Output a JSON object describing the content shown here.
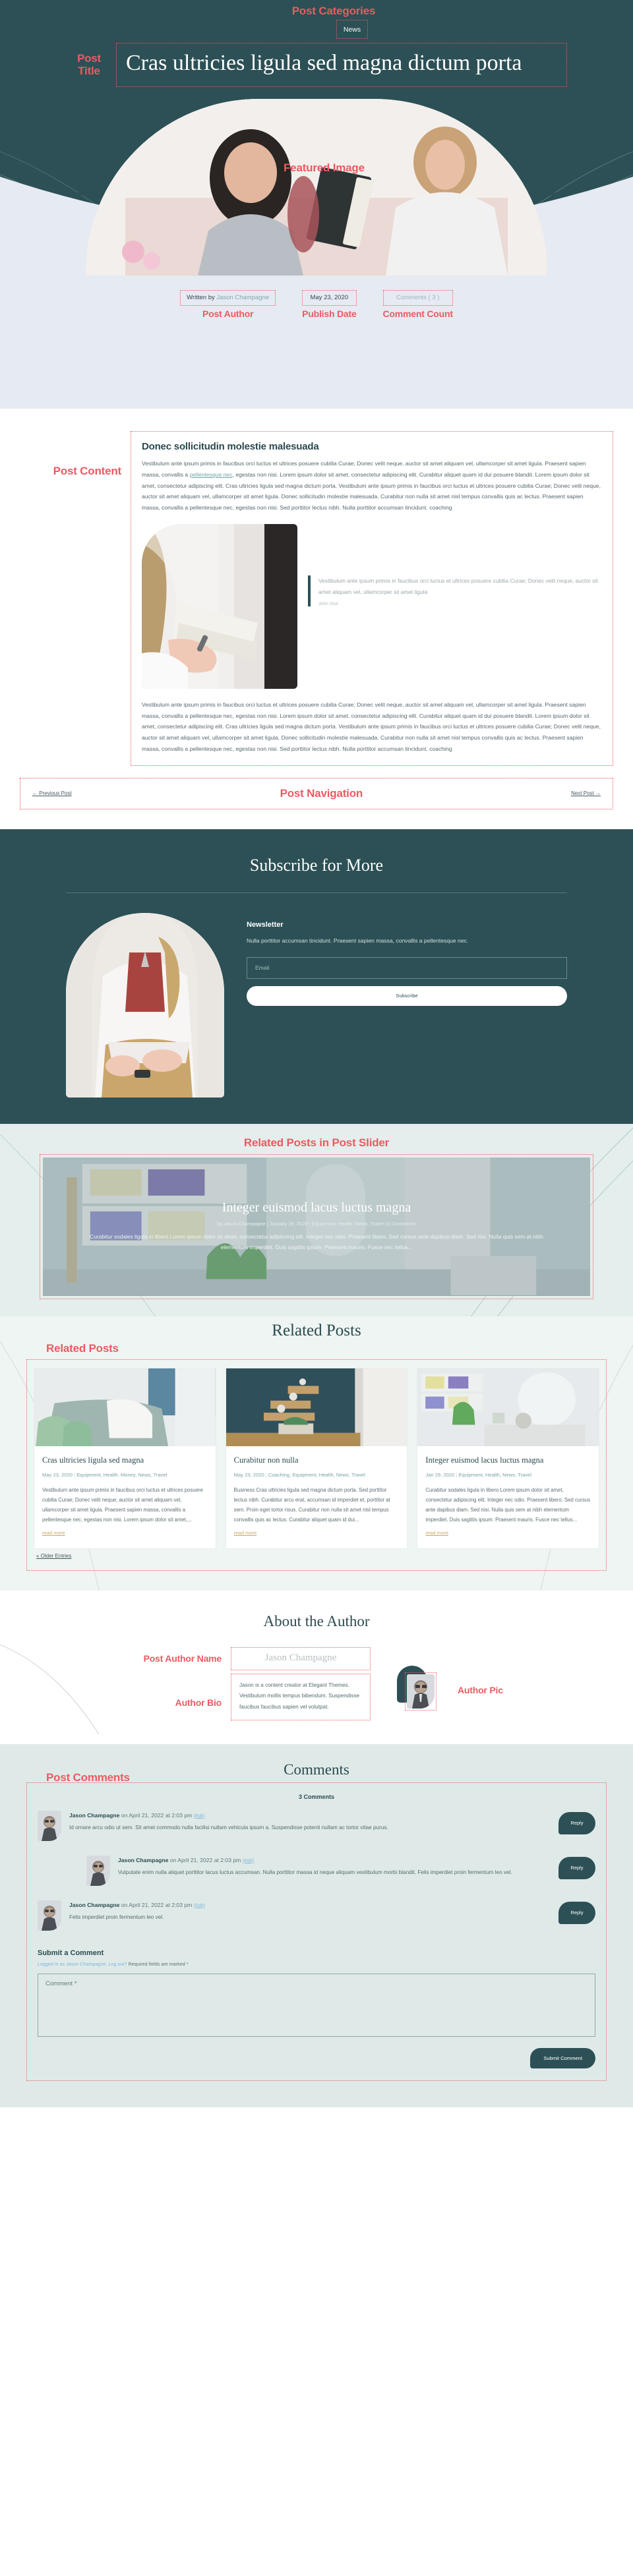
{
  "annotations": {
    "post_categories": "Post Categories",
    "post_title": "Post\nTitle",
    "post_title_line1": "Post",
    "post_title_line2": "Title",
    "featured_image": "Featured Image",
    "post_author": "Post Author",
    "publish_date": "Publish Date",
    "comment_count": "Comment Count",
    "post_content": "Post Content",
    "post_navigation": "Post Navigation",
    "related_posts_slider": "Related Posts in Post Slider",
    "related_posts": "Related Posts",
    "post_author_name": "Post Author Name",
    "author_bio": "Author Bio",
    "author_pic": "Author Pic",
    "post_comments": "Post Comments"
  },
  "colors": {
    "accent_red": "#ec5a62",
    "brand_teal": "#2c5055",
    "hero_lower": "#e6eaf2",
    "mint": "#dfeae8",
    "gold": "#c8a96a"
  },
  "hero": {
    "category": "News",
    "title": "Cras ultricies ligula sed magna dictum porta",
    "meta": {
      "written_by_prefix": "Written by ",
      "author": "Jason Champagne",
      "date": "May 23, 2020",
      "comments": "Comments ( 3 )"
    }
  },
  "content": {
    "heading": "Donec sollicitudin molestie malesuada",
    "paragraph1_a": "Vestibulum ante ipsum primis in faucibus orci luctus et ultrices posuere cubilia Curae; Donec velit neque, auctor sit amet aliquam vel, ullamcorper sit amet ligula. Praesent sapien massa, convallis a ",
    "paragraph1_link": "pellentesque nec",
    "paragraph1_b": ", egestas non nisi. Lorem ipsum dolor sit amet, consectetur adipiscing elit. Curabitur aliquet quam id dui posuere blandit. Lorem ipsum dolor sit amet, consectetur adipiscing elit. Cras ultricies ligula sed magna dictum porta. Vestibulum ante ipsum primis in faucibus orci luctus et ultrices posuere cubilia Curae; Donec velit neque, auctor sit amet aliquam vel, ullamcorper sit amet ligula. Donec sollicitudin molestie malesuada. Curabitur non nulla sit amet nisl tempus convallis quis ac lectus. Praesent sapien massa, convallis a pellentesque nec, egestas non nisi. Sed porttitor lectus nibh. Nulla porttitor accumsan tincidunt. coaching",
    "quote": "Vestibulum ante ipsum primis in faucibus orci luctus et ultrices posuere cubilia Curae; Donec velit neque, auctor sit amet aliquam vel, ullamcorper sit amet ligula",
    "quote_cite": "John Doe",
    "paragraph2": "Vestibulum ante ipsum primis in faucibus orci luctus et ultrices posuere cubilia Curae; Donec velit neque, auctor sit amet aliquam vel, ullamcorper sit amet ligula. Praesent sapien massa, convallis a pellentesque nec, egestas non nisi. Lorem ipsum dolor sit amet, consectetur adipiscing elit. Curabitur aliquet quam id dui posuere blandit. Lorem ipsum dolor sit amet, consectetur adipiscing elit. Cras ultricies ligula sed magna dictum porta. Vestibulum ante ipsum primis in faucibus orci luctus et ultrices posuere cubilia Curae; Donec velit neque, auctor sit amet aliquam vel, ullamcorper sit amet ligula. Donec sollicitudin molestie malesuada. Curabitur non nulla sit amet nisl tempus convallis quis ac lectus. Praesent sapien massa, convallis a pellentesque nec, egestas non nisi. Sed porttitor lectus nibh. Nulla porttitor accumsan tincidunt. coaching"
  },
  "navigation": {
    "previous": "← Previous Post",
    "next": "Next Post →"
  },
  "subscribe": {
    "title": "Subscribe for More",
    "newsletter_heading": "Newsletter",
    "newsletter_text": "Nulla porttitor accumsan tincidunt. Praesent sapien massa, convallis a pellentesque nec.",
    "email_placeholder": "Email",
    "email_value": "",
    "button": "Subscribe"
  },
  "slider": {
    "title": "Integer euismod lacus luctus magna",
    "meta": "by Jason Champagne | January 29, 2020 | Equipment, Health, News, Travel | 0 Comments",
    "excerpt": "Curabitur sodales ligula in libero Lorem ipsum dolor sit amet, consectetur adipiscing elit. Integer nec odio. Praesent libero. Sed cursus ante dapibus diam. Sed nisi. Nulla quis sem at nibh elementum imperdiet. Duis sagittis ipsum. Praesent mauris. Fusce nec tellus..."
  },
  "related": {
    "heading": "Related Posts",
    "older_entries": "« Older Entries",
    "read_more": "read more",
    "cards": [
      {
        "title": "Cras ultricies ligula sed magna",
        "date": "May 23, 2020",
        "categories": "Equipment, Health, Money, News, Travel",
        "excerpt": "Vestibulum ante ipsum primis in faucibus orci luctus et ultrices posuere cubilia Curae; Donec velit neque, auctor sit amet aliquam vel, ullamcorper sit amet ligula. Praesent sapien massa, convallis a pellentesque nec, egestas non nisi. Lorem ipsum dolor sit amet,..."
      },
      {
        "title": "Curabitur non nulla",
        "date": "May 23, 2020",
        "categories": "Coaching, Equipment, Health, News, Travel",
        "excerpt": "Business Cras ultricies ligula sed magna dictum porta. Sed porttitor lectus nibh. Curabitur arcu erat, accumsan id imperdiet et, porttitor at sem. Proin eget tortor risus. Curabitur non nulla sit amet nisl tempus convallis quis ac lectus. Curabitur aliquet quam id dui..."
      },
      {
        "title": "Integer euismod lacus luctus magna",
        "date": "Jan 29, 2020",
        "categories": "Equipment, Health, News, Travel",
        "excerpt": "Curabitur sodales ligula in libero Lorem ipsum dolor sit amet, consectetur adipiscing elit. Integer nec odio. Praesent libero. Sed cursus ante dapibus diam. Sed nisi. Nulla quis sem at nibh elementum imperdiet. Duis sagittis ipsum. Praesent mauris. Fusce nec tellus..."
      }
    ]
  },
  "author": {
    "heading": "About the Author",
    "name": "Jason Champagne",
    "bio": "Jason is a content creator at Elegant Themes. Vestibulum mollis tempus bibendum. Suspendisse faucibus faucibus sapien vel volutpat."
  },
  "comments": {
    "heading": "Comments",
    "count_label": "3 Comments",
    "reply_label": "Reply",
    "edit_label": "(Edit)",
    "items": [
      {
        "author": "Jason Champagne",
        "on": " on April 21, 2022 at 2:03 pm ",
        "text": "Id ornare arcu odio ut sem. Sit amet commodo nulla facilisi nullam vehicula ipsum a. Suspendisse potenti nullam ac tortor vitae purus."
      },
      {
        "author": "Jason Champagne",
        "on": " on April 21, 2022 at 2:03 pm ",
        "text": "Vulputate enim nulla aliquet porttitor lacus luctus accumsan. Nulla porttitor massa id neque aliquam vestibulum morbi blandit. Felis imperdiet proin fermentum leo vel."
      },
      {
        "author": "Jason Champagne",
        "on": " on April 21, 2022 at 2:03 pm ",
        "text": "Felis imperdiet proin fermentum leo vel."
      }
    ],
    "form": {
      "title": "Submit a Comment",
      "note_link": "Logged in as Jason Champagne. Log out?",
      "note_rest": " Required fields are marked *",
      "textarea_placeholder": "Comment *",
      "textarea_value": "",
      "submit": "Submit Comment"
    }
  }
}
